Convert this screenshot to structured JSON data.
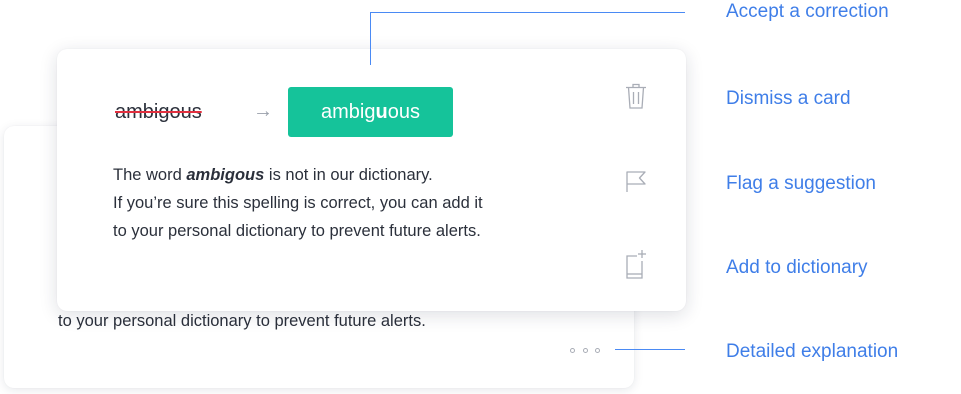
{
  "card": {
    "original_word": "ambigous",
    "suggestion_prefix": "ambig",
    "suggestion_highlight": "u",
    "suggestion_suffix": "ous",
    "arrow": "→",
    "explanation_prefix": "The word ",
    "explanation_word": "ambigous",
    "explanation_suffix": " is not in our dictionary.",
    "explanation_line2": "If you’re sure this spelling is correct, you can add it",
    "explanation_line3": "to your personal dictionary to prevent future alerts."
  },
  "back_card": {
    "text": "to your personal dictionary to prevent future alerts."
  },
  "icons": {
    "dismiss": "trash-icon",
    "flag": "flag-icon",
    "add": "add-to-dictionary-icon",
    "more": "more-dots-icon"
  },
  "callouts": {
    "accept": "Accept a correction",
    "dismiss": "Dismiss a card",
    "flag": "Flag a suggestion",
    "add": "Add to dictionary",
    "detail": "Detailed explanation"
  },
  "colors": {
    "accent_green": "#15c39a",
    "callout_blue": "#3f7ee8",
    "strike_red": "#e2303f",
    "icon_gray": "#a9adb6"
  }
}
